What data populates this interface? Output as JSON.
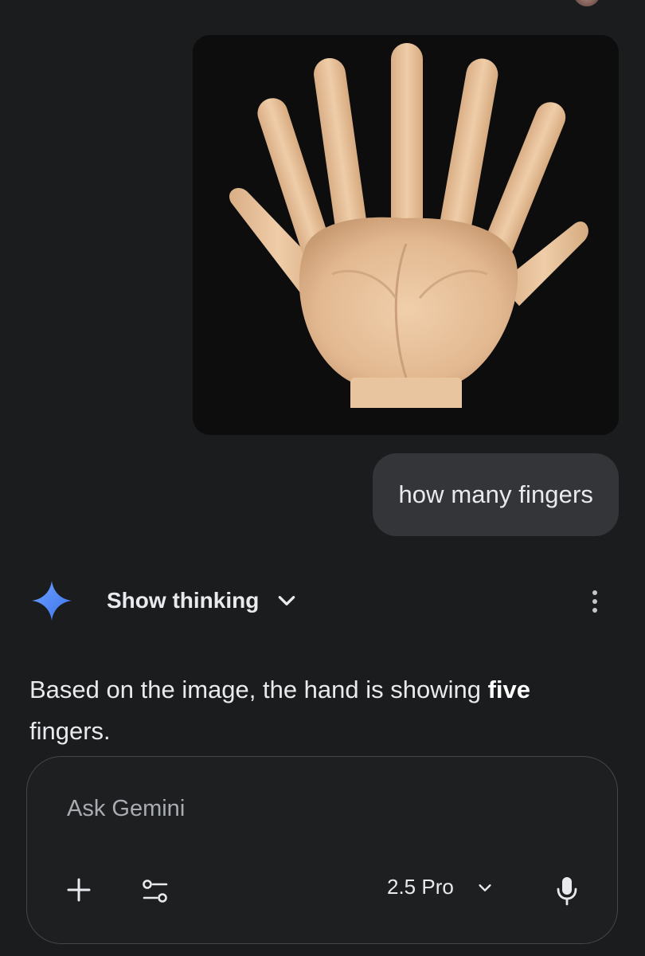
{
  "conversation": {
    "user_image": {
      "icon": "hand-image"
    },
    "user_message": "how many fingers",
    "response": {
      "show_thinking_label": "Show thinking",
      "text_before": "Based on the image, the hand is showing ",
      "text_bold": "five",
      "text_after": " fingers."
    }
  },
  "composer": {
    "placeholder": "Ask Gemini",
    "model_label": "2.5 Pro"
  },
  "icons": {
    "gemini": "gemini-sparkle-icon",
    "chevron": "chevron-down-icon",
    "more": "more-vertical-icon",
    "plus": "plus-icon",
    "tools": "tools-icon",
    "mic": "mic-icon"
  },
  "colors": {
    "background": "#1b1c1e",
    "bubble": "#333538",
    "text": "#e8eaed",
    "gemini_blue": "#4285f4",
    "skin": "#e6c09b"
  }
}
